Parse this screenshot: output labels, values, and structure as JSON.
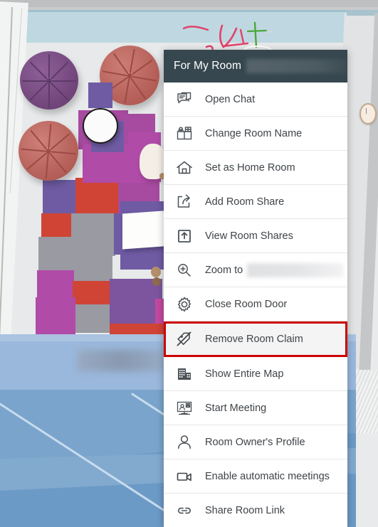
{
  "scene": {
    "description": "Top-down virtual office room map with poufs, rug, desk, chair",
    "redacted_label": "",
    "colors": {
      "wall_band": "#bfd7e0",
      "floor": "#e7e9ea",
      "water_light": "#9ab8dc",
      "water_deep": "#6c9ac7",
      "rug_purple": "#7c559e",
      "rug_magenta": "#b14ba8",
      "rug_red": "#d04436",
      "rug_grey": "#9a9aa2",
      "pouf_purple": "#7b4f86",
      "pouf_red": "#c26a62"
    },
    "annotations": {
      "ink_red": "#e0436b",
      "ink_green": "#4aa83d"
    }
  },
  "context_menu": {
    "header": {
      "title": "For My Room",
      "redacted": true
    },
    "highlight_color": "#cc0000",
    "items": [
      {
        "label": "Open Chat",
        "icon": "chat-icon",
        "redacted": false,
        "highlighted": false
      },
      {
        "label": "Change Room Name",
        "icon": "rename-room-icon",
        "redacted": false,
        "highlighted": false
      },
      {
        "label": "Set as Home Room",
        "icon": "home-icon",
        "redacted": false,
        "highlighted": false
      },
      {
        "label": "Add Room Share",
        "icon": "share-add-icon",
        "redacted": false,
        "highlighted": false
      },
      {
        "label": "View Room Shares",
        "icon": "share-view-icon",
        "redacted": false,
        "highlighted": false
      },
      {
        "label": "Zoom to",
        "icon": "zoom-in-icon",
        "redacted": true,
        "highlighted": false
      },
      {
        "label": "Close Room Door",
        "icon": "gear-icon",
        "redacted": false,
        "highlighted": false
      },
      {
        "label": "Remove Room Claim",
        "icon": "remove-claim-icon",
        "redacted": false,
        "highlighted": true
      },
      {
        "label": "Show Entire Map",
        "icon": "building-map-icon",
        "redacted": false,
        "highlighted": false
      },
      {
        "label": "Start Meeting",
        "icon": "meeting-screen-icon",
        "redacted": false,
        "highlighted": false
      },
      {
        "label": "Room Owner's Profile",
        "icon": "person-icon",
        "redacted": false,
        "highlighted": false
      },
      {
        "label": "Enable automatic meetings",
        "icon": "video-camera-icon",
        "redacted": false,
        "highlighted": false
      },
      {
        "label": "Share Room Link",
        "icon": "link-icon",
        "redacted": false,
        "highlighted": false
      }
    ]
  }
}
